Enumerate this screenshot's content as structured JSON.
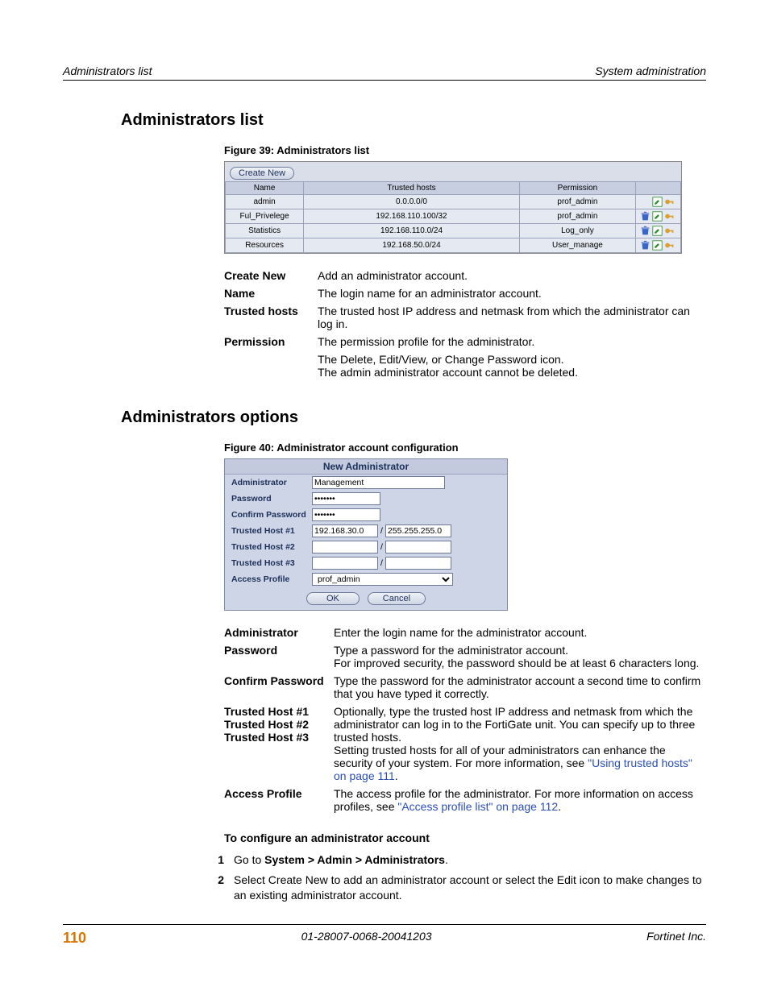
{
  "header": {
    "left": "Administrators list",
    "right": "System administration"
  },
  "sectionA": {
    "title": "Administrators list",
    "figcap": "Figure 39: Administrators list",
    "createBtn": "Create New",
    "cols": {
      "name": "Name",
      "hosts": "Trusted hosts",
      "perm": "Permission"
    },
    "rows": [
      {
        "name": "admin",
        "hosts": "0.0.0.0/0",
        "perm": "prof_admin",
        "icons": "ek"
      },
      {
        "name": "Ful_Privelege",
        "hosts": "192.168.110.100/32",
        "perm": "prof_admin",
        "icons": "dek"
      },
      {
        "name": "Statistics",
        "hosts": "192.168.110.0/24",
        "perm": "Log_only",
        "icons": "dek"
      },
      {
        "name": "Resources",
        "hosts": "192.168.50.0/24",
        "perm": "User_manage",
        "icons": "dek"
      }
    ],
    "defs": [
      {
        "k": "Create New",
        "v": "Add an administrator account."
      },
      {
        "k": "Name",
        "v": "The login name for an administrator account."
      },
      {
        "k": "Trusted hosts",
        "v": "The trusted host IP address and netmask from which the administrator can log in."
      },
      {
        "k": "Permission",
        "v": "The permission profile for the administrator."
      },
      {
        "k": "",
        "v": "The Delete, Edit/View, or Change Password icon.\nThe admin administrator account cannot be deleted."
      }
    ]
  },
  "sectionB": {
    "title": "Administrators options",
    "figcap": "Figure 40: Administrator account configuration",
    "formTitle": "New Administrator",
    "labels": {
      "admin": "Administrator",
      "pw": "Password",
      "cpw": "Confirm Password",
      "th1": "Trusted Host #1",
      "th2": "Trusted Host #2",
      "th3": "Trusted Host #3",
      "ap": "Access Profile"
    },
    "values": {
      "admin": "Management",
      "pwmask": "•••••••",
      "th1a": "192.168.30.0",
      "th1b": "255.255.255.0",
      "ap": "prof_admin",
      "slash": "/",
      "ok": "OK",
      "cancel": "Cancel"
    },
    "defs": [
      {
        "k": "Administrator",
        "v": "Enter the login name for the administrator account."
      },
      {
        "k": "Password",
        "v": "Type a password for the administrator account.\nFor improved security, the password should be at least 6 characters long."
      },
      {
        "k": "Confirm Password",
        "v": "Type the password for the administrator account a second time to confirm that you have typed it correctly."
      },
      {
        "k": "Trusted Host #1\nTrusted Host #2\nTrusted Host #3",
        "v": "Optionally, type the trusted host IP address and netmask from which the administrator can log in to the FortiGate unit. You can specify up to three trusted hosts.\nSetting trusted hosts for all of your administrators can enhance the security of your system. For more information, see ",
        "link": "\"Using trusted hosts\" on page 111",
        "tail": "."
      },
      {
        "k": "Access Profile",
        "v": "The access profile for the administrator. For more information on access profiles, see ",
        "link": "\"Access profile list\" on page 112",
        "tail": "."
      }
    ],
    "sub": "To configure an administrator account",
    "steps": [
      {
        "n": "1",
        "pre": "Go to ",
        "bold": "System > Admin > Administrators",
        "post": "."
      },
      {
        "n": "2",
        "txt": "Select Create New to add an administrator account or select the Edit icon to make changes to an existing administrator account."
      }
    ]
  },
  "footer": {
    "page": "110",
    "mid": "01-28007-0068-20041203",
    "right": "Fortinet Inc."
  }
}
